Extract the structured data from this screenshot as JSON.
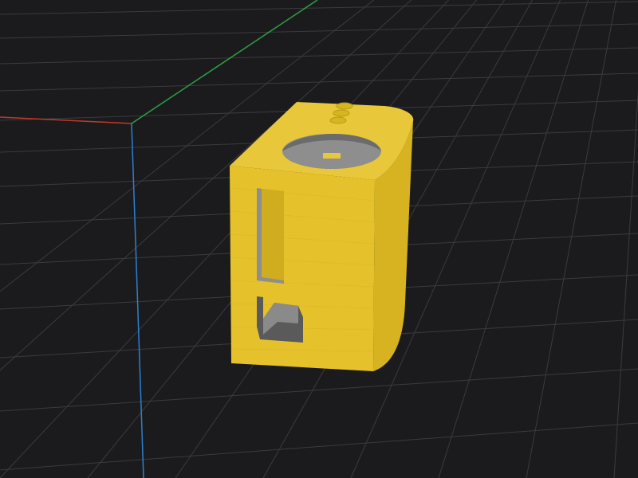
{
  "viewport": {
    "background_color": "#1b1b1d",
    "grid_color": "#3a3b3f",
    "axis_colors": {
      "x": "#c0392b",
      "y": "#2ea043",
      "z": "#2f7fd0"
    }
  },
  "model": {
    "color_front": "#e7c42f",
    "color_side": "#d7b321",
    "color_top": "#edce3a",
    "cutout_color": "#8e8e8e",
    "cutout_shadow_color": "#5a5a5a"
  }
}
